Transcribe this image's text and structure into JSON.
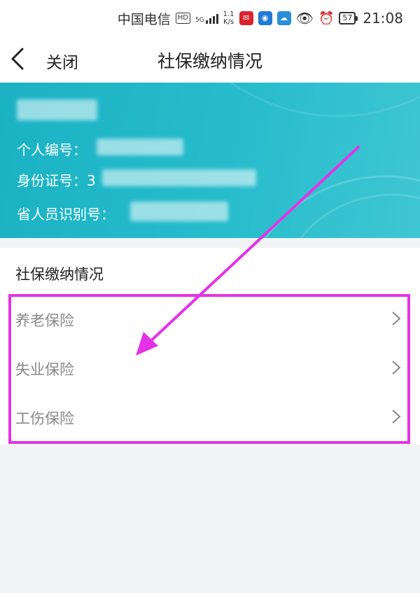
{
  "status_bar": {
    "carrier": "中国电信",
    "hd": "HD",
    "network": "5G",
    "speed_value": "1.1",
    "speed_unit": "K/s",
    "battery": "57",
    "time": "21:08"
  },
  "nav": {
    "close_label": "关闭",
    "title": "社保缴纳情况"
  },
  "profile": {
    "id_label": "个人编号：",
    "idcard_label": "身份证号：",
    "idcard_visible": "3",
    "provincial_label": "省人员识别号："
  },
  "section": {
    "title": "社保缴纳情况",
    "items": [
      {
        "label": "养老保险"
      },
      {
        "label": "失业保险"
      },
      {
        "label": "工伤保险"
      }
    ]
  },
  "colors": {
    "hero": "#1ab2c3",
    "annotation": "#e532e6"
  }
}
